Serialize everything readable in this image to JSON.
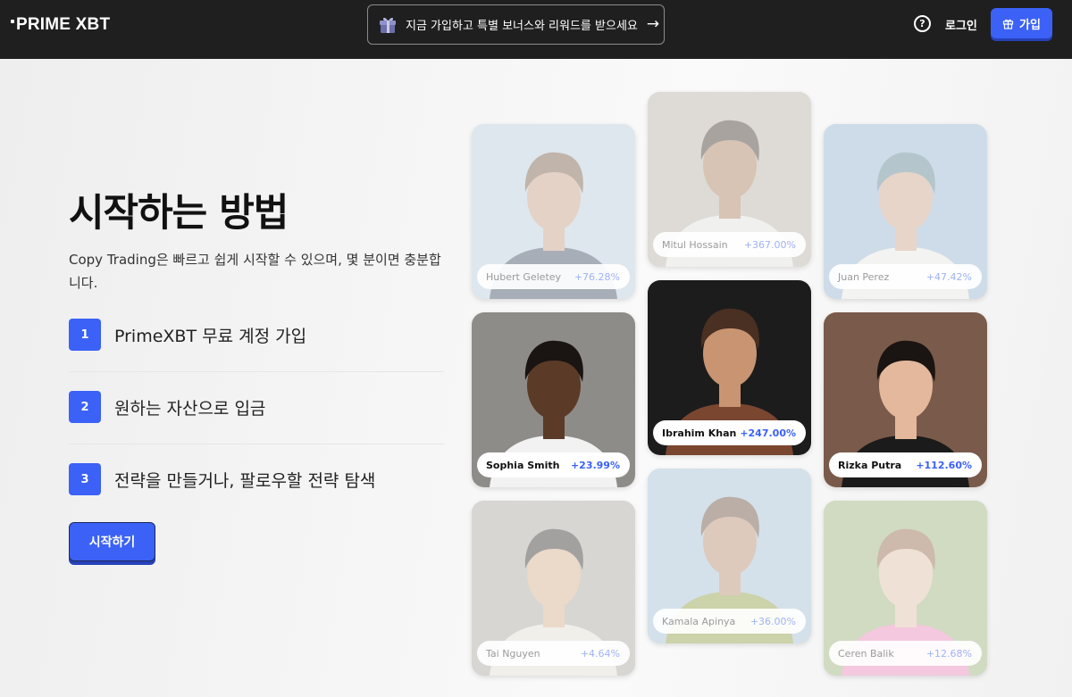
{
  "header": {
    "logo": "PRIME XBT",
    "promo_text": "지금 가입하고 특별 보너스와 리워드를 받으세요",
    "login_label": "로그인",
    "signup_label": "가입",
    "help_glyph": "?"
  },
  "main": {
    "title": "시작하는 방법",
    "description": "Copy Trading은 빠르고 쉽게 시작할 수 있으며, 몇 분이면 충분합니다.",
    "steps": [
      {
        "num": "1",
        "label": "PrimeXBT 무료 계정 가입"
      },
      {
        "num": "2",
        "label": "원하는 자산으로 입금"
      },
      {
        "num": "3",
        "label": "전략을 만들거나, 팔로우할 전략 탐색"
      }
    ],
    "cta_label": "시작하기"
  },
  "traders": [
    {
      "name": "Hubert Geletey",
      "gain": "+76.28%",
      "dim": true,
      "bg": "#b9cfe0",
      "skin": "#c99a79",
      "hair": "#6b4a33",
      "shirt": "#2b3a55"
    },
    {
      "name": "Mitul Hossain",
      "gain": "+367.00%",
      "dim": true,
      "bg": "#b7b0a6",
      "skin": "#a7734e",
      "hair": "#2b1d14",
      "shirt": "#e8e6e1"
    },
    {
      "name": "Juan Perez",
      "gain": "+47.42%",
      "dim": true,
      "bg": "#8fb4d6",
      "skin": "#d1a084",
      "hair": "#4a7a8a",
      "shirt": "#f0efe9"
    },
    {
      "name": "Sophia Smith",
      "gain": "+23.99%",
      "dim": false,
      "bg": "#8e8c88",
      "skin": "#5b3a28",
      "hair": "#1a1412",
      "shirt": "#f2f2f2"
    },
    {
      "name": "Ibrahim Khan",
      "gain": "+247.00%",
      "dim": false,
      "bg": "#1c1c1c",
      "skin": "#c89472",
      "hair": "#4a3022",
      "shirt": "#7a4630"
    },
    {
      "name": "Rizka Putra",
      "gain": "+112.60%",
      "dim": false,
      "bg": "#7a5a4a",
      "skin": "#e3b89c",
      "hair": "#1a1412",
      "shirt": "#1b1b1b"
    },
    {
      "name": "Tai Nguyen",
      "gain": "+4.64%",
      "dim": true,
      "bg": "#a8a49a",
      "skin": "#d9ab85",
      "hair": "#1d1a16",
      "shirt": "#e9e4d8"
    },
    {
      "name": "Kamala Apinya",
      "gain": "+36.00%",
      "dim": true,
      "bg": "#9fc0da",
      "skin": "#b98263",
      "hair": "#5a3a25",
      "shirt": "#8a9a2e"
    },
    {
      "name": "Ceren Balik",
      "gain": "+12.68%",
      "dim": true,
      "bg": "#97b06e",
      "skin": "#e7c0a2",
      "hair": "#8b5a35",
      "shirt": "#f17fb7"
    }
  ],
  "colors": {
    "accent": "#3b61f6",
    "header_bg": "#1f1f1f",
    "page_bg": "#f4f4f4"
  }
}
